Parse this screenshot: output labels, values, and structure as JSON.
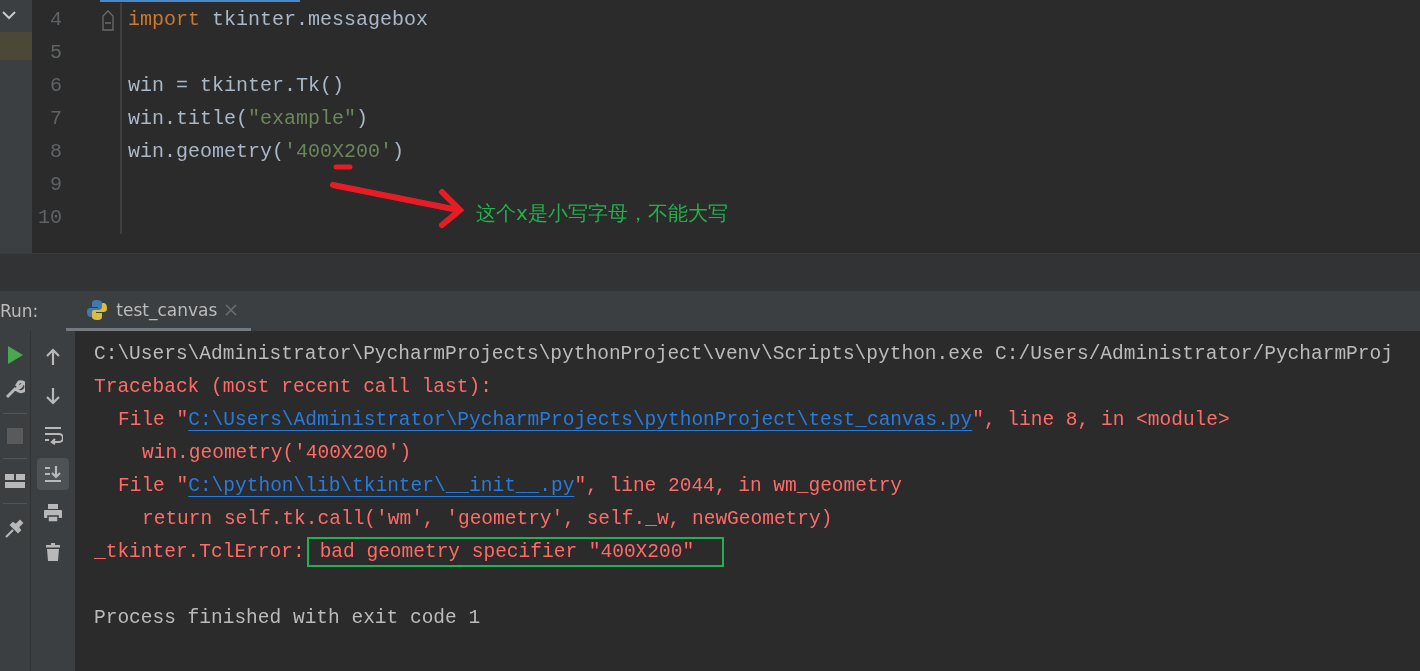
{
  "editor": {
    "lines": [
      {
        "number": "4",
        "fold": true,
        "tokens": [
          {
            "kind": "keyword",
            "text": "import"
          },
          {
            "kind": "plain",
            "text": " tkinter.messagebox"
          }
        ]
      },
      {
        "number": "5",
        "fold": false
      },
      {
        "number": "6",
        "fold": false,
        "tokens": [
          {
            "kind": "plain",
            "text": "win = tkinter.Tk()"
          }
        ]
      },
      {
        "number": "7",
        "fold": false,
        "tokens": [
          {
            "kind": "plain",
            "text": "win.title("
          },
          {
            "kind": "string",
            "text": "\"example\""
          },
          {
            "kind": "plain",
            "text": ")"
          }
        ]
      },
      {
        "number": "8",
        "fold": false,
        "tokens": [
          {
            "kind": "plain",
            "text": "win.geometry("
          },
          {
            "kind": "string",
            "text": "'400X200'"
          },
          {
            "kind": "plain",
            "text": ")"
          }
        ]
      },
      {
        "number": "9",
        "fold": false
      },
      {
        "number": "10",
        "fold": false
      }
    ]
  },
  "annotation": {
    "note": "这个x是小写字母，不能大写"
  },
  "run": {
    "label": "Run:",
    "tabs": [
      {
        "title": "test_canvas",
        "selected": true
      }
    ]
  },
  "console_toolbar": [
    {
      "selected": false
    },
    {
      "selected": false
    },
    {
      "selected": false
    },
    {
      "selected": true
    },
    {
      "selected": false
    },
    {
      "selected": false
    }
  ],
  "console": [
    {
      "kind": "plain",
      "segments": [
        {
          "kind": "plain",
          "text": "C:\\Users\\Administrator\\PycharmProjects\\pythonProject\\venv\\Scripts\\python.exe C:/Users/Administrator/PycharmProj"
        }
      ]
    },
    {
      "kind": "plain",
      "segments": [
        {
          "kind": "error",
          "text": "Traceback (most recent call last):"
        }
      ]
    },
    {
      "kind": "frame",
      "segments": [
        {
          "kind": "error",
          "text": "File \""
        },
        {
          "kind": "link",
          "text": "C:\\Users\\Administrator\\PycharmProjects\\pythonProject\\test_canvas.py"
        },
        {
          "kind": "error",
          "text": "\", line 8, in <module>"
        }
      ]
    },
    {
      "kind": "source",
      "segments": [
        {
          "kind": "error",
          "text": "win.geometry('400X200')"
        }
      ]
    },
    {
      "kind": "frame",
      "segments": [
        {
          "kind": "error",
          "text": "File \""
        },
        {
          "kind": "link",
          "text": "C:\\python\\lib\\tkinter\\__init__.py"
        },
        {
          "kind": "error",
          "text": "\", line 2044, in wm_geometry"
        }
      ]
    },
    {
      "kind": "source",
      "segments": [
        {
          "kind": "error",
          "text": "return self.tk.call('wm', 'geometry', self._w, newGeometry)"
        }
      ]
    },
    {
      "kind": "plain",
      "segments": [
        {
          "kind": "error",
          "text": "_tkinter.TclError:"
        },
        {
          "kind": "highlight",
          "text": "bad geometry specifier \"400X200\""
        }
      ]
    },
    {
      "kind": "status",
      "segments": [
        {
          "kind": "plain",
          "text": "Process finished with exit code 1"
        }
      ]
    }
  ]
}
